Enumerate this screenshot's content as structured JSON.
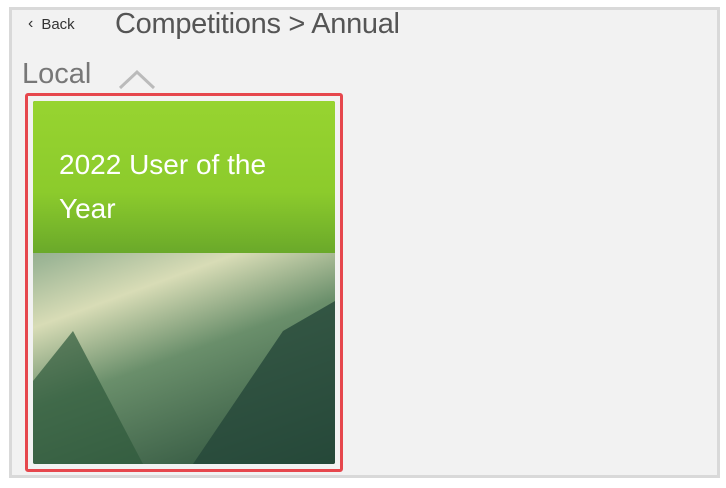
{
  "header": {
    "back_label": "Back",
    "title": "Competitions > Annual"
  },
  "section": {
    "label": "Local"
  },
  "cards": [
    {
      "title": "2022 User of the Year"
    }
  ],
  "colors": {
    "selection": "#e6474d",
    "card_header": "#8ccb2c"
  }
}
